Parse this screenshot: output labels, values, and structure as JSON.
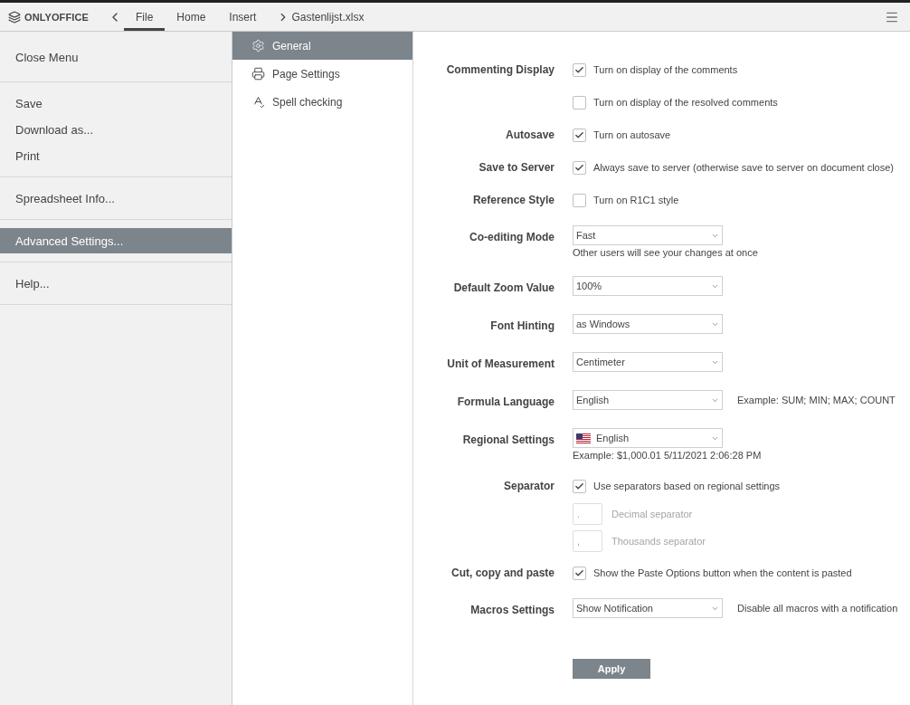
{
  "header": {
    "logo": "ONLYOFFICE",
    "tabs": [
      {
        "label": "File",
        "selected": true
      },
      {
        "label": "Home",
        "selected": false
      },
      {
        "label": "Insert",
        "selected": false
      }
    ],
    "document_title": "Gastenlijst.xlsx"
  },
  "file_menu": {
    "groups": [
      [
        {
          "label": "Close Menu",
          "selected": false
        }
      ],
      [
        {
          "label": "Save",
          "selected": false
        },
        {
          "label": "Download as...",
          "selected": false
        },
        {
          "label": "Print",
          "selected": false
        }
      ],
      [
        {
          "label": "Spreadsheet Info...",
          "selected": false
        }
      ],
      [
        {
          "label": "Advanced Settings...",
          "selected": true
        }
      ],
      [
        {
          "label": "Help...",
          "selected": false
        }
      ]
    ]
  },
  "settings_nav": [
    {
      "label": "General",
      "kind": "gear",
      "selected": true
    },
    {
      "label": "Page Settings",
      "kind": "printer",
      "selected": false
    },
    {
      "label": "Spell checking",
      "kind": "spell",
      "selected": false
    }
  ],
  "settings": [
    {
      "label": "Commenting Display",
      "controls": [
        {
          "kind": "checkbox",
          "text": "Turn on display of the comments",
          "checked": true
        },
        {
          "kind": "checkbox",
          "text": "Turn on display of the resolved comments",
          "checked": false
        }
      ]
    },
    {
      "label": "Autosave",
      "controls": [
        {
          "kind": "checkbox",
          "text": "Turn on autosave",
          "checked": true
        }
      ]
    },
    {
      "label": "Save to Server",
      "controls": [
        {
          "kind": "checkbox",
          "text": "Always save to server (otherwise save to server on document close)",
          "checked": true
        }
      ]
    },
    {
      "label": "Reference Style",
      "controls": [
        {
          "kind": "checkbox",
          "text": "Turn on R1C1 style",
          "checked": false
        }
      ]
    },
    {
      "label": "Co-editing Mode",
      "controls": [
        {
          "kind": "select",
          "value": "Fast",
          "hint": "Other users will see your changes at once"
        }
      ]
    },
    {
      "label": "Default Zoom Value",
      "controls": [
        {
          "kind": "select",
          "value": "100%"
        }
      ]
    },
    {
      "label": "Font Hinting",
      "controls": [
        {
          "kind": "select",
          "value": "as Windows"
        }
      ]
    },
    {
      "label": "Unit of Measurement",
      "controls": [
        {
          "kind": "select",
          "value": "Centimeter"
        }
      ]
    },
    {
      "label": "Formula Language",
      "controls": [
        {
          "kind": "select",
          "value": "English",
          "side_text": "Example: SUM; MIN; MAX; COUNT"
        }
      ]
    },
    {
      "label": "Regional Settings",
      "controls": [
        {
          "kind": "select",
          "value": "English",
          "flag": true,
          "hint": "Example: $1,000.01 5/11/2021 2:06:28 PM"
        }
      ]
    },
    {
      "label": "Separator",
      "controls": [
        {
          "kind": "checkbox",
          "text": "Use separators based on regional settings",
          "checked": true
        },
        {
          "kind": "field",
          "value": ".",
          "text": "Decimal separator",
          "disabled": true
        },
        {
          "kind": "field",
          "value": ",",
          "text": "Thousands separator",
          "disabled": true
        }
      ]
    },
    {
      "label": "Cut, copy and paste",
      "controls": [
        {
          "kind": "checkbox",
          "text": "Show the Paste Options button when the content is pasted",
          "checked": true
        }
      ]
    },
    {
      "label": "Macros Settings",
      "controls": [
        {
          "kind": "select",
          "value": "Show Notification",
          "side_text": "Disable all macros with a notification"
        }
      ]
    }
  ],
  "apply_button": "Apply"
}
